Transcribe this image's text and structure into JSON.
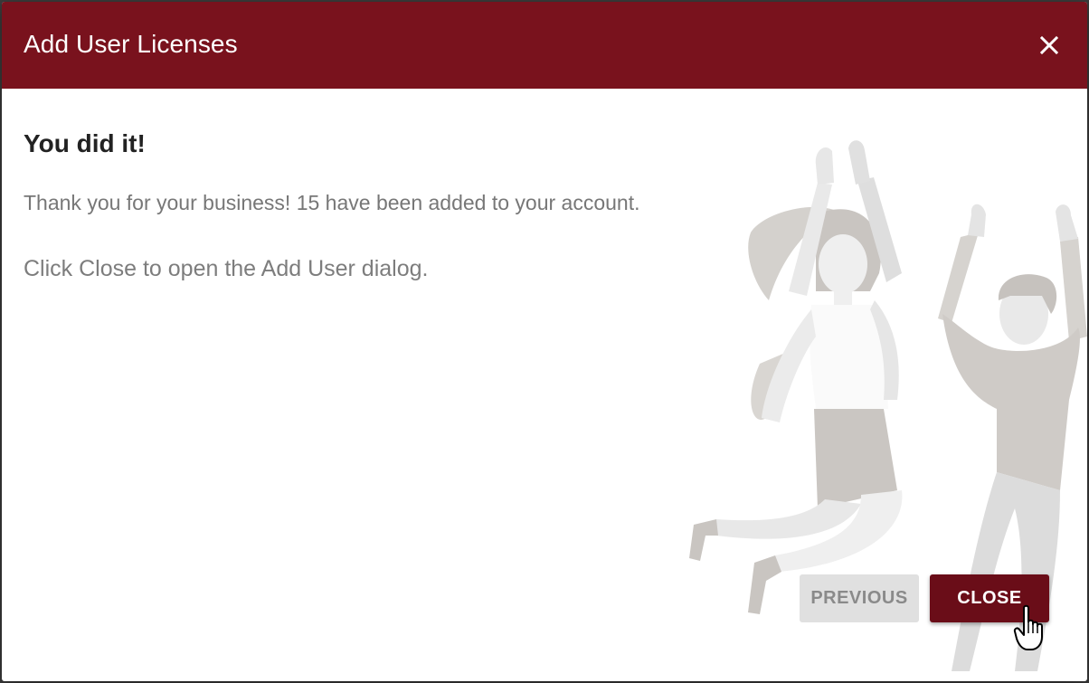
{
  "dialog": {
    "title": "Add User Licenses",
    "heading": "You did it!",
    "message": "Thank you for your business! 15 have been added to your account.",
    "instruction": "Click Close to open the Add User dialog.",
    "buttons": {
      "previous": "PREVIOUS",
      "close": "CLOSE"
    }
  },
  "icons": {
    "close": "close-icon",
    "illustration": "celebrating-people-illustration",
    "cursor": "hand-pointer-cursor"
  },
  "colors": {
    "header": "#79121d",
    "primary_button": "#6a0d18",
    "secondary_button": "#e0e0e0"
  }
}
